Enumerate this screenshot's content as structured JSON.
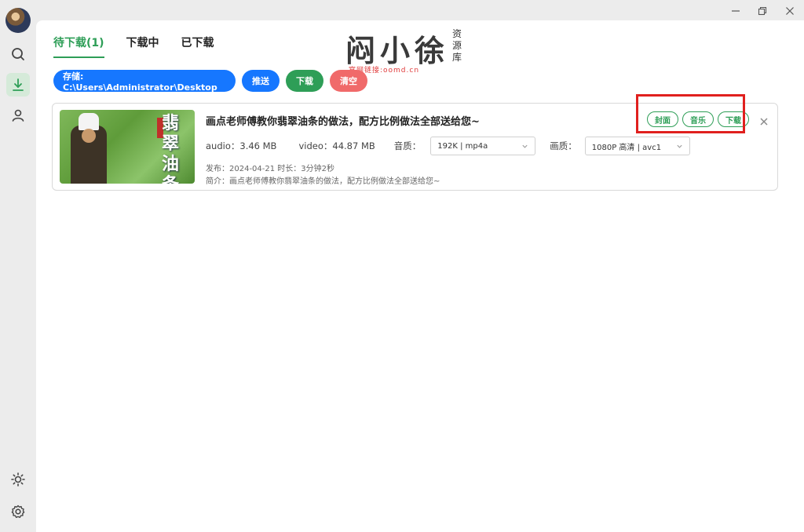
{
  "sidebar": {
    "items": [
      {
        "icon": "search-icon"
      },
      {
        "icon": "download-icon",
        "active": true
      },
      {
        "icon": "user-icon"
      }
    ],
    "bottom": [
      {
        "icon": "sun-icon"
      },
      {
        "icon": "gear-icon"
      }
    ]
  },
  "tabs": [
    {
      "label": "待下载(1)",
      "active": true
    },
    {
      "label": "下载中"
    },
    {
      "label": "已下载"
    }
  ],
  "toolbar": {
    "storage_label": "存储: C:\\Users\\Administrator\\Desktop",
    "push_label": "推送",
    "download_label": "下载",
    "clear_label": "清空"
  },
  "watermark": {
    "main": "闷小徐",
    "side": "资源库",
    "sub": "官网链接:oomd.cn"
  },
  "item": {
    "title": "画点老师傅教你翡翠油条的做法，配方比例做法全部送给您~",
    "thumb_text": "翡翠油条",
    "actions": {
      "cover": "封面",
      "music": "音乐",
      "download": "下载"
    },
    "audio_label": "audio：",
    "audio_size": "3.46 MB",
    "video_label": "video：",
    "video_size": "44.87 MB",
    "audio_quality_label": "音质：",
    "audio_quality_value": "192K | mp4a",
    "video_quality_label": "画质：",
    "video_quality_value": "1080P 高清 | avc1",
    "publish": "发布：2024-04-21 时长：3分钟2秒",
    "intro": "简介：画点老师傅教你翡翠油条的做法，配方比例做法全部送给您~"
  },
  "colors": {
    "accent": "#2e9e57",
    "blue": "#1677ff",
    "red": "#f06a6a",
    "highlight": "#e0201e"
  }
}
